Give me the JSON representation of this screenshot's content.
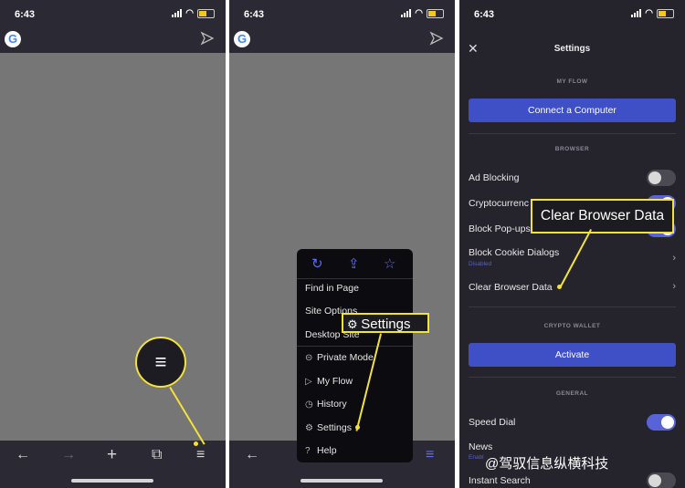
{
  "status": {
    "time": "6:43"
  },
  "panel1": {
    "bottom_icons": [
      "back-arrow-icon",
      "forward-arrow-icon",
      "plus-icon",
      "tabs-icon",
      "menu-icon"
    ]
  },
  "panel2": {
    "menu": {
      "top_icons": [
        "refresh-icon",
        "share-icon",
        "star-icon"
      ],
      "items": [
        {
          "label": "Find in Page",
          "icon": ""
        },
        {
          "label": "Site Options",
          "icon": ""
        },
        {
          "label": "Desktop Site",
          "icon": ""
        },
        {
          "label": "Private Mode",
          "icon": "private-icon"
        },
        {
          "label": "My Flow",
          "icon": "send-icon"
        },
        {
          "label": "History",
          "icon": "clock-icon"
        },
        {
          "label": "Settings",
          "icon": "gear-icon"
        },
        {
          "label": "Help",
          "icon": "help-icon"
        }
      ]
    },
    "callout": "Settings"
  },
  "settings": {
    "title": "Settings",
    "my_flow_header": "MY FLOW",
    "connect_button": "Connect a Computer",
    "browser_header": "BROWSER",
    "ad_blocking": "Ad Blocking",
    "crypto": "Cryptocurrenc",
    "block_popups": "Block Pop-ups",
    "block_cookie": "Block Cookie Dialogs",
    "block_cookie_sub": "Disabled",
    "clear_data": "Clear Browser Data",
    "crypto_wallet_header": "CRYPTO WALLET",
    "activate_button": "Activate",
    "general_header": "GENERAL",
    "speed_dial": "Speed Dial",
    "news": "News",
    "news_sub": "Enabl",
    "instant_search": "Instant Search",
    "callout": "Clear Browser Data"
  },
  "watermark": "@驾驭信息纵横科技",
  "colors": {
    "accent": "#f2e23a",
    "button": "#3f4fc5",
    "toggle_on": "#5863d8"
  }
}
